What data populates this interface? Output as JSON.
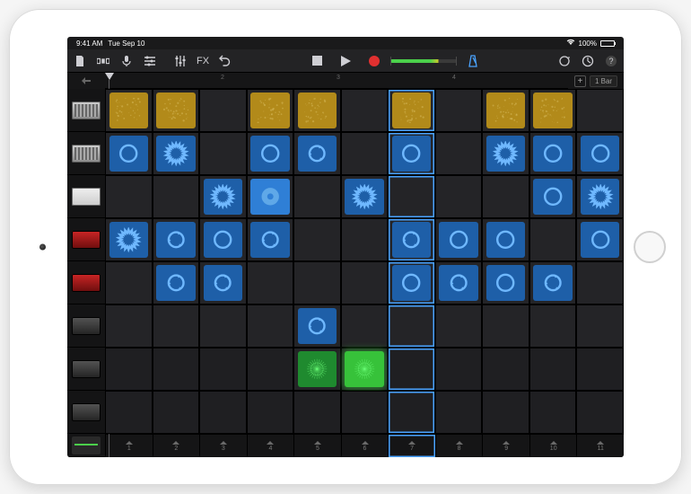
{
  "status": {
    "time": "9:41 AM",
    "date": "Tue Sep 10",
    "battery": "100%"
  },
  "toolbar": {
    "mixer_label": "FX",
    "volume_level": 0.72
  },
  "ruler": {
    "marks": [
      "2",
      "3",
      "4"
    ],
    "add_label": "+",
    "bars_label": "1 Bar"
  },
  "tracks": [
    {
      "instr": "drum"
    },
    {
      "instr": "drum"
    },
    {
      "instr": "keys"
    },
    {
      "instr": "keys-red"
    },
    {
      "instr": "keys-red"
    },
    {
      "instr": "keys-dark"
    },
    {
      "instr": "keys-dark"
    },
    {
      "instr": "keys-dark"
    },
    {
      "instr": "fader"
    }
  ],
  "columns": 11,
  "selected_column": 6,
  "cells": {
    "0": {
      "0": {
        "c": "yellow",
        "p": 1
      },
      "1": {
        "c": "yellow",
        "p": 1
      },
      "3": {
        "c": "yellow",
        "p": 1
      },
      "4": {
        "c": "yellow",
        "p": 1
      },
      "6": {
        "c": "yellow",
        "p": 1
      },
      "8": {
        "c": "yellow",
        "p": 1
      },
      "9": {
        "c": "yellow",
        "p": 1
      }
    },
    "1": {
      "0": {
        "c": "blue",
        "p": 2
      },
      "1": {
        "c": "blue",
        "p": 3
      },
      "3": {
        "c": "blue",
        "p": 2
      },
      "4": {
        "c": "blue",
        "p": 4
      },
      "6": {
        "c": "blue",
        "p": 2
      },
      "8": {
        "c": "blue",
        "p": 3
      },
      "9": {
        "c": "blue",
        "p": 2
      },
      "10": {
        "c": "blue",
        "p": 2
      }
    },
    "2": {
      "2": {
        "c": "blue",
        "p": 3
      },
      "3": {
        "c": "blue",
        "p": 5,
        "bright": 1
      },
      "5": {
        "c": "blue",
        "p": 3
      },
      "9": {
        "c": "blue",
        "p": 2
      },
      "10": {
        "c": "blue",
        "p": 3
      }
    },
    "3": {
      "0": {
        "c": "blue",
        "p": 3
      },
      "1": {
        "c": "blue",
        "p": 4
      },
      "2": {
        "c": "blue",
        "p": 2
      },
      "3": {
        "c": "blue",
        "p": 4
      },
      "6": {
        "c": "blue",
        "p": 4
      },
      "7": {
        "c": "blue",
        "p": 2
      },
      "8": {
        "c": "blue",
        "p": 2
      },
      "10": {
        "c": "blue",
        "p": 2
      }
    },
    "4": {
      "1": {
        "c": "blue",
        "p": 4
      },
      "2": {
        "c": "blue",
        "p": 4
      },
      "6": {
        "c": "blue",
        "p": 2
      },
      "7": {
        "c": "blue",
        "p": 4
      },
      "8": {
        "c": "blue",
        "p": 2
      },
      "9": {
        "c": "blue",
        "p": 4
      }
    },
    "5": {
      "4": {
        "c": "blue",
        "p": 4
      }
    },
    "6": {
      "4": {
        "c": "green",
        "p": 6
      },
      "5": {
        "c": "green",
        "p": 6,
        "bright": 1
      }
    },
    "7": {}
  },
  "bottom": {
    "labels": [
      "1",
      "2",
      "3",
      "4",
      "5",
      "6",
      "7",
      "8",
      "9",
      "10",
      "11"
    ]
  }
}
